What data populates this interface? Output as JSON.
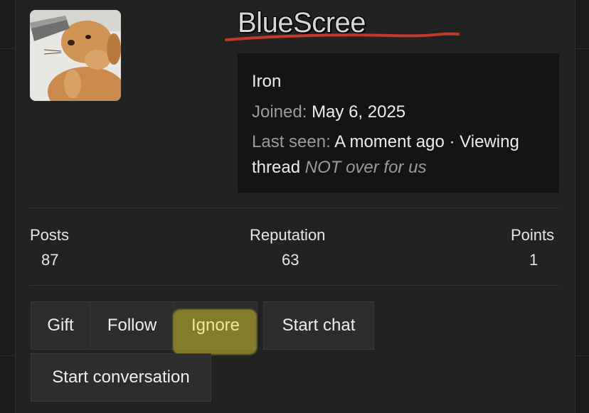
{
  "profile": {
    "username": "BlueScree",
    "rank": "Iron",
    "joined_label": "Joined:",
    "joined_value": "May 6, 2025",
    "last_seen_label": "Last seen:",
    "last_seen_value": "A moment ago · Viewing",
    "last_seen_value_2": "thread",
    "thread_name": "NOT over for us"
  },
  "stats": [
    {
      "label": "Posts",
      "value": "87"
    },
    {
      "label": "Reputation",
      "value": "63"
    },
    {
      "label": "Points",
      "value": "1"
    }
  ],
  "actions": {
    "gift": "Gift",
    "follow": "Follow",
    "ignore": "Ignore",
    "start_chat": "Start chat",
    "start_conversation": "Start conversation"
  },
  "colors": {
    "username_underline": "#c0392b",
    "ignore_highlight": "#cdbe28",
    "card_bg": "#222222",
    "info_bg": "#141414"
  },
  "icons": {
    "avatar": "dog-avatar-image"
  }
}
